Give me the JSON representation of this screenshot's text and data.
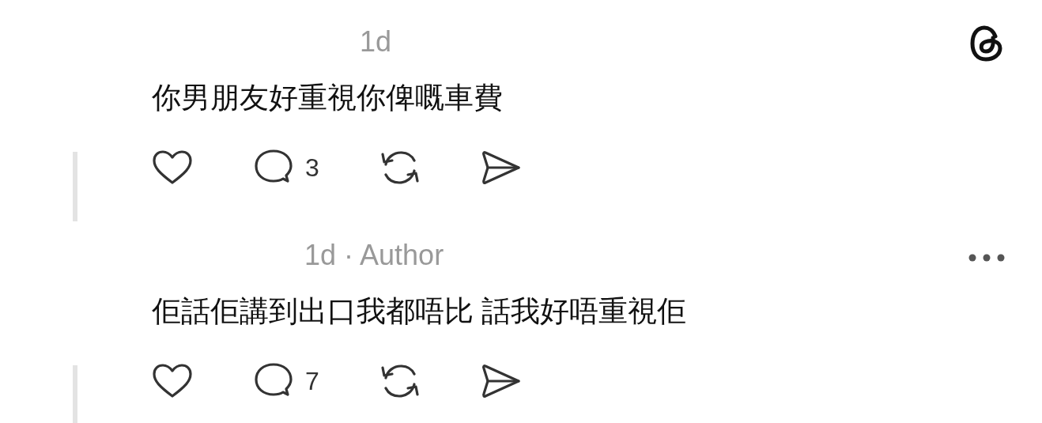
{
  "posts": [
    {
      "meta": "1d",
      "text": "你男朋友好重視你俾嘅車費",
      "replies": "3",
      "has_menu": false,
      "has_logo": true
    },
    {
      "meta": "1d · Author",
      "text": "佢話佢講到出口我都唔比 話我好唔重視佢",
      "replies": "7",
      "has_menu": true,
      "has_logo": false
    }
  ]
}
